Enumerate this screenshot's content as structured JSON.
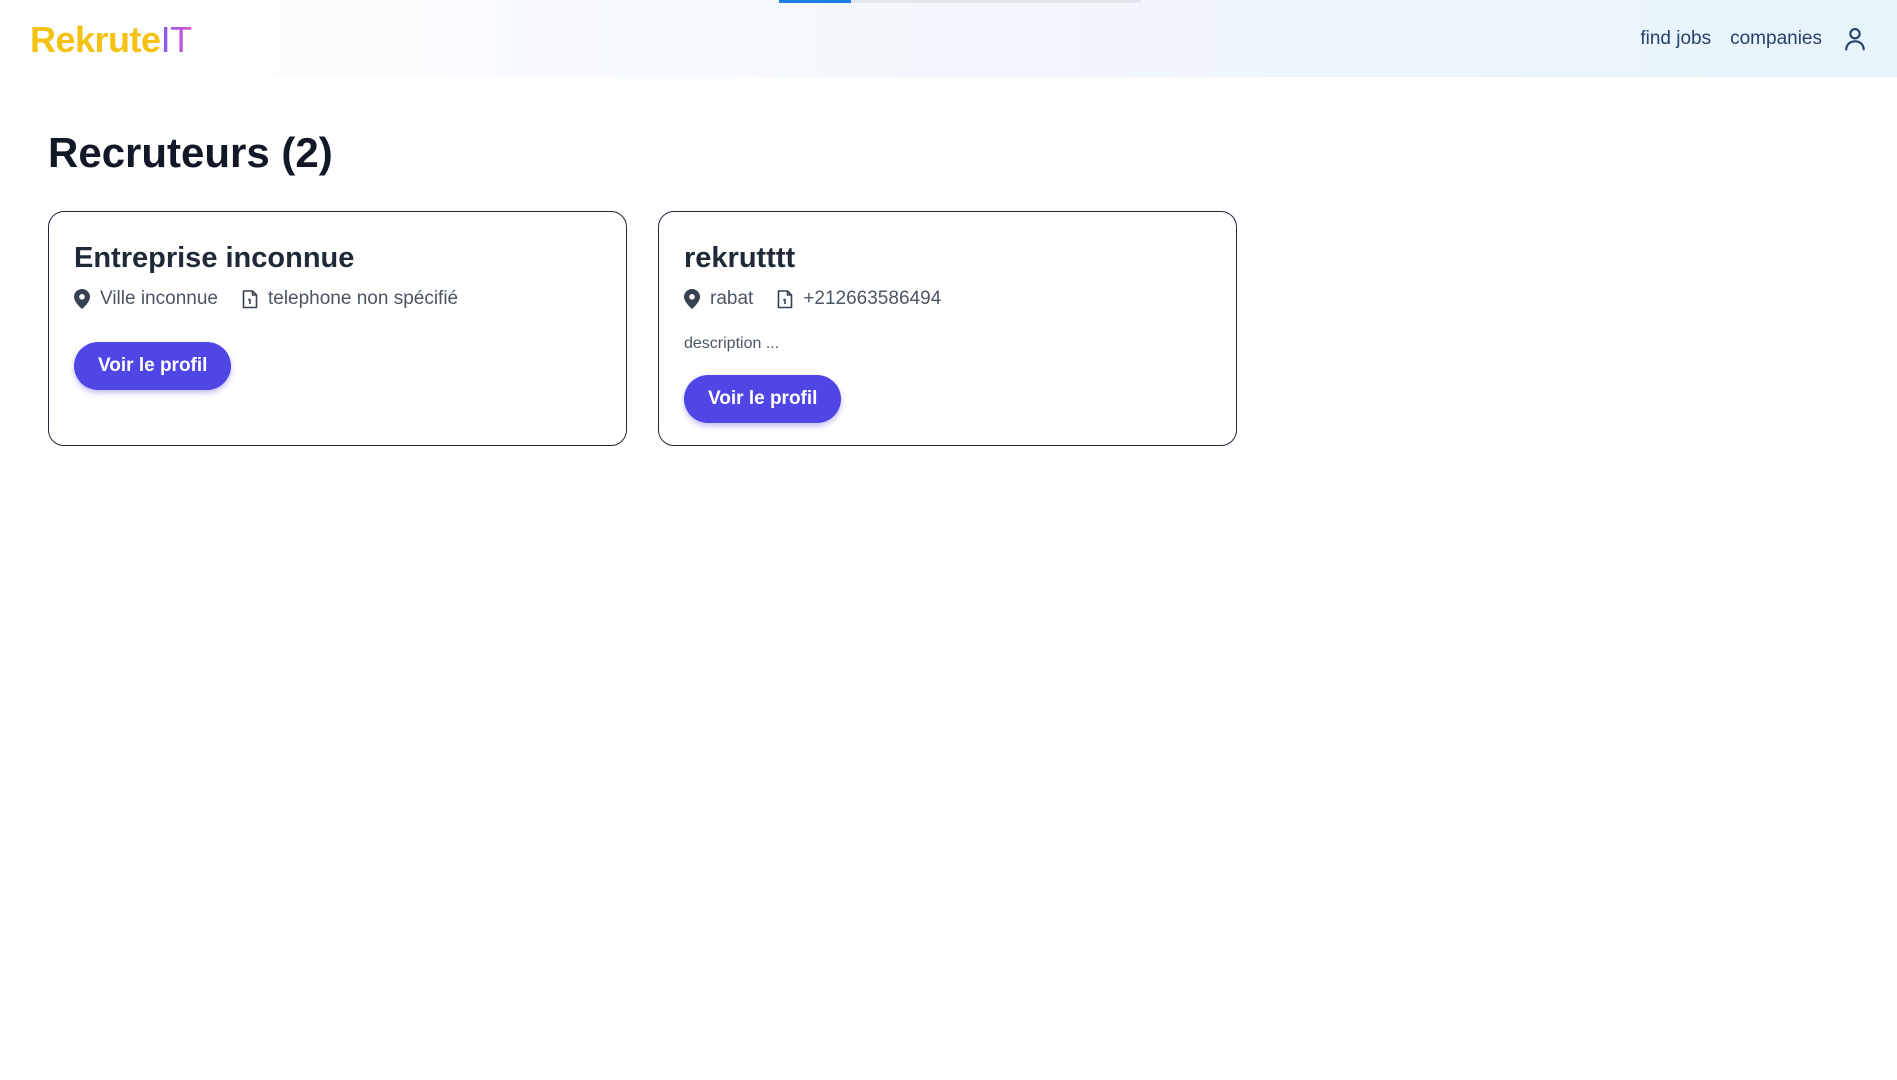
{
  "colors": {
    "logo_primary": "#f5c211",
    "logo_accent": "#b45ad8",
    "nav_text": "#27406e",
    "progress": "#1e7ee6",
    "button_bg": "#4f46e5",
    "title_text": "#111827"
  },
  "header": {
    "logo_part1": "Rekrute",
    "logo_part2": "IT",
    "nav": {
      "find_jobs": "find jobs",
      "companies": "companies",
      "user_icon": "user-icon"
    },
    "loading_progress": 0.2
  },
  "main": {
    "title": "Recruteurs (2)",
    "recruiters": [
      {
        "name": "Entreprise inconnue",
        "city": "Ville inconnue",
        "phone": "telephone non spécifié",
        "description": "",
        "button": "Voir le profil",
        "icons": [
          "location-pin-icon",
          "document-icon"
        ]
      },
      {
        "name": "rekrutttt",
        "city": "rabat",
        "phone": "+212663586494",
        "description": "description ...",
        "button": "Voir le profil",
        "icons": [
          "location-pin-icon",
          "document-icon"
        ]
      }
    ]
  }
}
